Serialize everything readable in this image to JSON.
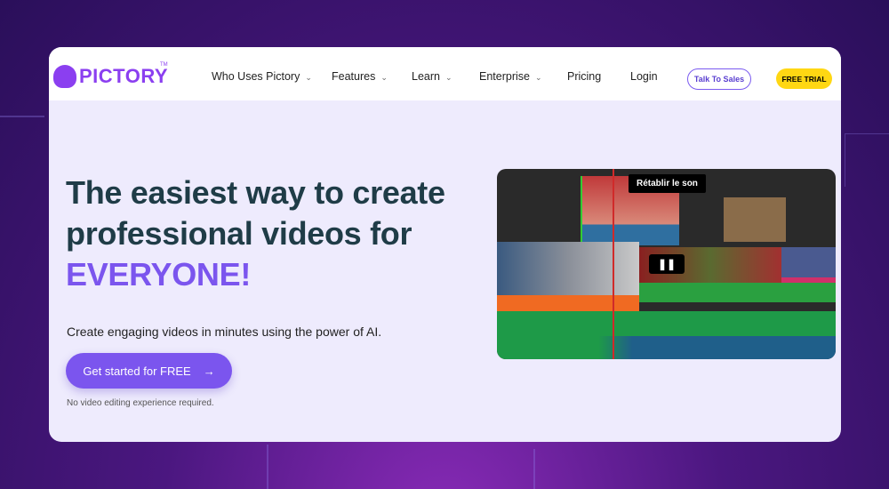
{
  "nav": {
    "logo": "PICTORY",
    "tm": "TM",
    "items": [
      {
        "label": "Who Uses Pictory",
        "dropdown": true
      },
      {
        "label": "Features",
        "dropdown": true
      },
      {
        "label": "Learn",
        "dropdown": true
      },
      {
        "label": "Enterprise",
        "dropdown": true
      },
      {
        "label": "Pricing",
        "dropdown": false
      },
      {
        "label": "Login",
        "dropdown": false
      }
    ],
    "talk": "Talk To Sales",
    "trial": "FREE TRIAL"
  },
  "hero": {
    "line1": "The easiest way to create",
    "line2": "professional videos for",
    "highlight": "EVERYONE!",
    "subtitle": "Create engaging videos in minutes using the power of AI.",
    "cta": "Get started for FREE",
    "cta_icon": "arrow-right-icon",
    "note": "No video editing experience required."
  },
  "video": {
    "tooltip": "Rétablir le son",
    "control": "pause-icon"
  },
  "colors": {
    "accent": "#7b55ee",
    "trial": "#ffd713",
    "heading": "#1f3c47"
  }
}
